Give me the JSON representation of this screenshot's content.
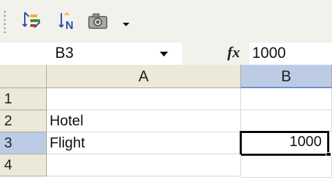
{
  "toolbar": {
    "icons": [
      "sort-ascending-icon",
      "sort-new-icon",
      "camera-icon",
      "toolbar-options-chevron-icon"
    ]
  },
  "formula_bar": {
    "name_box": "B3",
    "fx_label": "fx",
    "formula_value": "1000"
  },
  "sheet": {
    "active_cell": "B3",
    "columns": [
      "A",
      "B"
    ],
    "rows": [
      {
        "label": "1",
        "A": "",
        "B": ""
      },
      {
        "label": "2",
        "A": "Hotel",
        "B": ""
      },
      {
        "label": "3",
        "A": "Flight",
        "B": "1000"
      },
      {
        "label": "4",
        "A": "",
        "B": ""
      }
    ]
  },
  "colors": {
    "header_bg": "#ece9d8",
    "header_active_bg": "#bccce6",
    "gridline": "#d0d7e5",
    "toolbar_bg": "#f2f1ec"
  }
}
